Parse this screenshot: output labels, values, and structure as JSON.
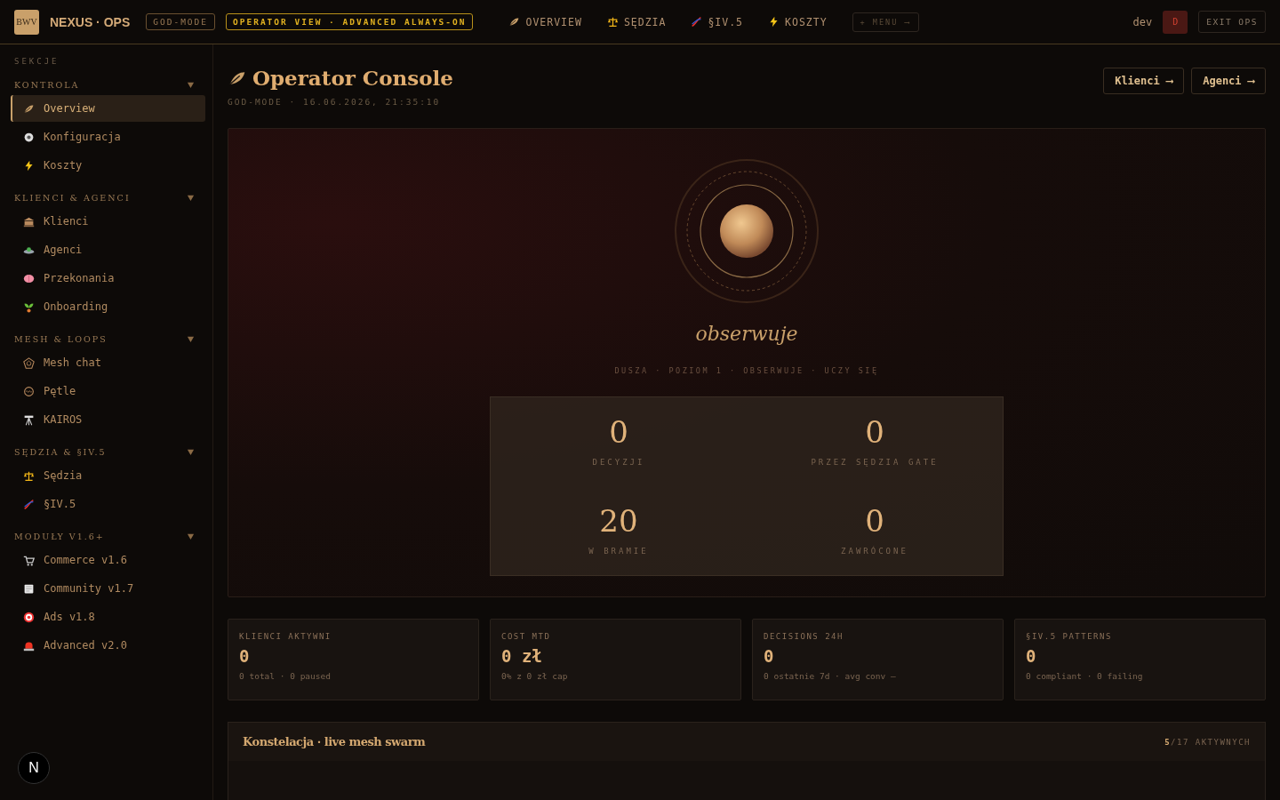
{
  "topbar": {
    "logo": "BWV",
    "brand": "NEXUS · OPS",
    "mode_badge": "GOD-MODE",
    "view_badge": "OPERATOR VIEW · ADVANCED ALWAYS-ON",
    "nav": [
      {
        "label": "OVERVIEW"
      },
      {
        "label": "SĘDZIA"
      },
      {
        "label": "§IV.5"
      },
      {
        "label": "KOSZTY"
      }
    ],
    "menu_button": "+ MENU ⟶",
    "user": "dev",
    "avatar": "D",
    "exit_button": "EXIT OPS"
  },
  "sidebar": {
    "heading": "SEKCJE",
    "groups": [
      {
        "title": "KONTROLA",
        "expanded": true,
        "items": [
          {
            "label": "Overview",
            "selected": true
          },
          {
            "label": "Konfiguracja",
            "selected": false
          },
          {
            "label": "Koszty",
            "selected": false
          }
        ]
      },
      {
        "title": "KLIENCI & AGENCI",
        "expanded": true,
        "items": [
          {
            "label": "Klienci",
            "selected": false
          },
          {
            "label": "Agenci",
            "selected": false
          },
          {
            "label": "Przekonania",
            "selected": false
          },
          {
            "label": "Onboarding",
            "selected": false
          }
        ]
      },
      {
        "title": "MESH & LOOPS",
        "expanded": true,
        "items": [
          {
            "label": "Mesh chat",
            "selected": false
          },
          {
            "label": "Pętle",
            "selected": false
          },
          {
            "label": "KAIROS",
            "selected": false
          }
        ]
      },
      {
        "title": "SĘDZIA & §IV.5",
        "expanded": true,
        "items": [
          {
            "label": "Sędzia",
            "selected": false
          },
          {
            "label": "§IV.5",
            "selected": false
          }
        ]
      },
      {
        "title": "MODUŁY V1.6+",
        "expanded": true,
        "items": [
          {
            "label": "Commerce v1.6",
            "selected": false
          },
          {
            "label": "Community v1.7",
            "selected": false
          },
          {
            "label": "Ads v1.8",
            "selected": false
          },
          {
            "label": "Advanced v2.0",
            "selected": false
          }
        ]
      }
    ],
    "footer_badge": "N"
  },
  "header": {
    "title": "Operator Console",
    "subtitle": "GOD-MODE · 16.06.2026, 21:35:10",
    "buttons": [
      "Klienci ⟶",
      "Agenci ⟶"
    ]
  },
  "hero": {
    "state": "obserwuje",
    "caption": "DUSZA · POZIOM 1 · OBSERWUJE · UCZY SIĘ",
    "stats": [
      {
        "value": "0",
        "label": "DECYZJI"
      },
      {
        "value": "0",
        "label": "PRZEZ SĘDZIA GATE"
      },
      {
        "value": "20",
        "label": "W BRAMIE"
      },
      {
        "value": "0",
        "label": "ZAWRÓCONE"
      }
    ]
  },
  "cards": [
    {
      "title": "KLIENCI AKTYWNI",
      "value": "0",
      "note": "0 total · 0 paused"
    },
    {
      "title": "COST MTD",
      "value": "0 zł",
      "note": "0% z 0 zł cap"
    },
    {
      "title": "DECISIONS 24H",
      "value": "0",
      "note": "0 ostatnie 7d · avg conv —"
    },
    {
      "title": "§IV.5 PATTERNS",
      "value": "0",
      "note": "0 compliant · 0 failing"
    }
  ],
  "constellation": {
    "title": "Konstelacja · live mesh swarm",
    "count": "**5**/17 AKTYWNYCH"
  }
}
